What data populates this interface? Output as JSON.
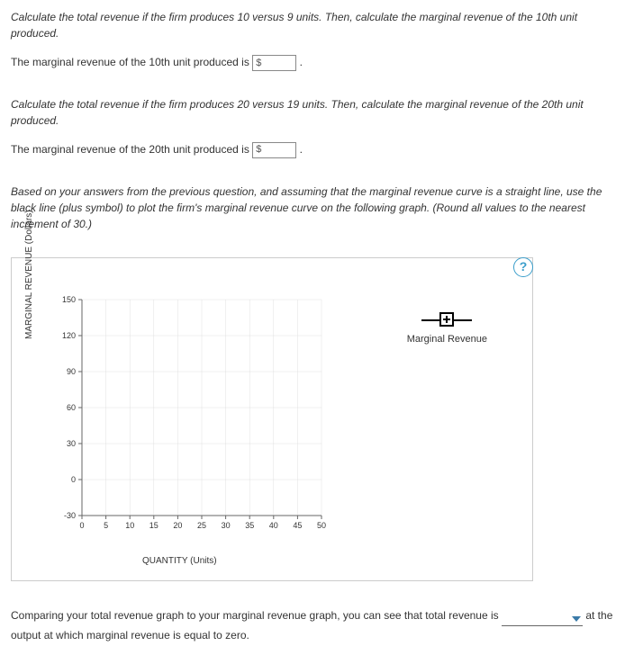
{
  "q1": {
    "prompt": "Calculate the total revenue if the firm produces 10 versus 9 units. Then, calculate the marginal revenue of the 10th unit produced.",
    "answer_prefix": "The marginal revenue of the 10th unit produced is",
    "currency": "$",
    "value": "",
    "suffix": "."
  },
  "q2": {
    "prompt": "Calculate the total revenue if the firm produces 20 versus 19 units. Then, calculate the marginal revenue of the 20th unit produced.",
    "answer_prefix": "The marginal revenue of the 20th unit produced is",
    "currency": "$",
    "value": "",
    "suffix": "."
  },
  "q3": {
    "prompt": "Based on your answers from the previous question, and assuming that the marginal revenue curve is a straight line, use the black line (plus symbol) to plot the firm's marginal revenue curve on the following graph. (Round all values to the nearest increment of 30.)"
  },
  "graph": {
    "help": "?",
    "ylabel": "MARGINAL REVENUE (Dollars)",
    "xlabel": "QUANTITY (Units)",
    "legend": "Marginal Revenue"
  },
  "chart_data": {
    "type": "scatter",
    "series": [],
    "x_ticks": [
      0,
      5,
      10,
      15,
      20,
      25,
      30,
      35,
      40,
      45,
      50
    ],
    "y_ticks": [
      -30,
      0,
      30,
      60,
      90,
      120,
      150
    ],
    "xlim": [
      0,
      50
    ],
    "ylim": [
      -30,
      150
    ],
    "xlabel": "QUANTITY (Units)",
    "ylabel": "MARGINAL REVENUE (Dollars)",
    "legend_series": "Marginal Revenue"
  },
  "final": {
    "pre": "Comparing your total revenue graph to your marginal revenue graph, you can see that total revenue is",
    "dropdown_value": "",
    "post": " at the output at which marginal revenue is equal to zero."
  }
}
